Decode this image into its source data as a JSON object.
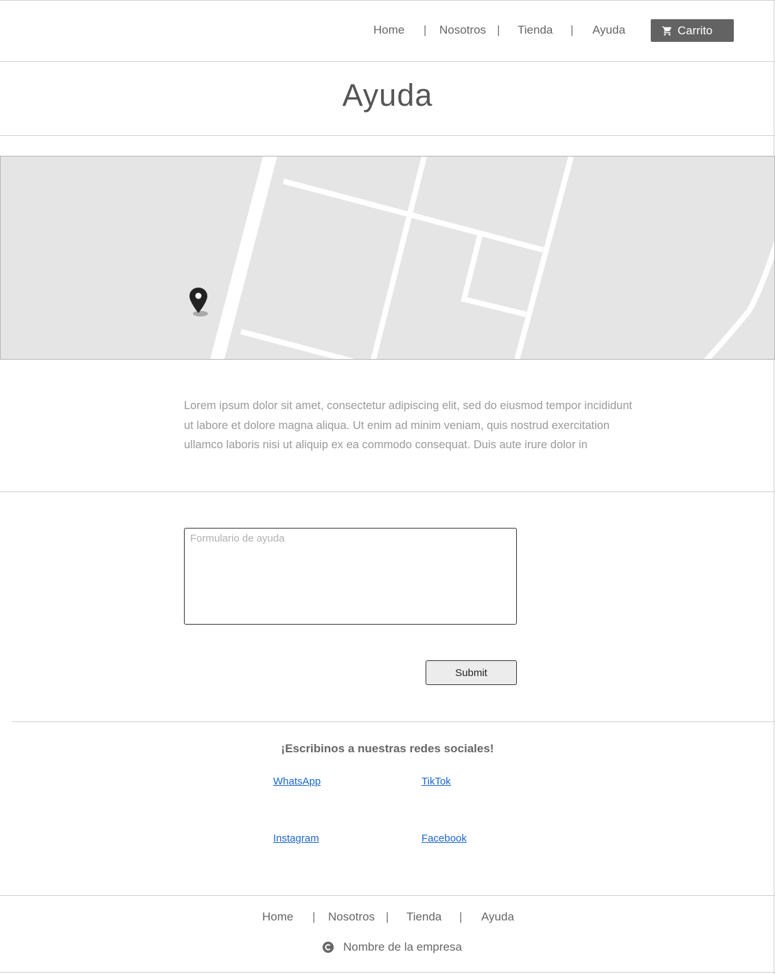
{
  "header": {
    "nav": [
      "Home",
      "Nosotros",
      "Tienda",
      "Ayuda"
    ],
    "cart_label": "Carrito",
    "cart_icon": "cart-icon",
    "cart_button_color": "#636363"
  },
  "page_title": "Ayuda",
  "map": {
    "background_color": "#e5e5e5",
    "marker_icon": "map-pin-icon"
  },
  "description": "Lorem ipsum dolor sit amet, consectetur adipiscing elit, sed do eiusmod tempor incididunt ut labore et dolore magna aliqua. Ut enim ad minim veniam, quis nostrud exercitation ullamco laboris nisi ut aliquip ex ea commodo consequat. Duis aute irure dolor in",
  "form": {
    "textarea_placeholder": "Formulario de ayuda",
    "textarea_value": "",
    "submit_label": "Submit"
  },
  "social": {
    "heading": "¡Escribinos a nuestras redes sociales!",
    "links": [
      "WhatsApp",
      "TikTok",
      "Instagram",
      "Facebook"
    ],
    "link_color": "#1a66cc"
  },
  "footer": {
    "nav": [
      "Home",
      "Nosotros",
      "Tienda",
      "Ayuda"
    ],
    "copyright_icon": "copyright-icon",
    "company_name": "Nombre de la empresa"
  }
}
